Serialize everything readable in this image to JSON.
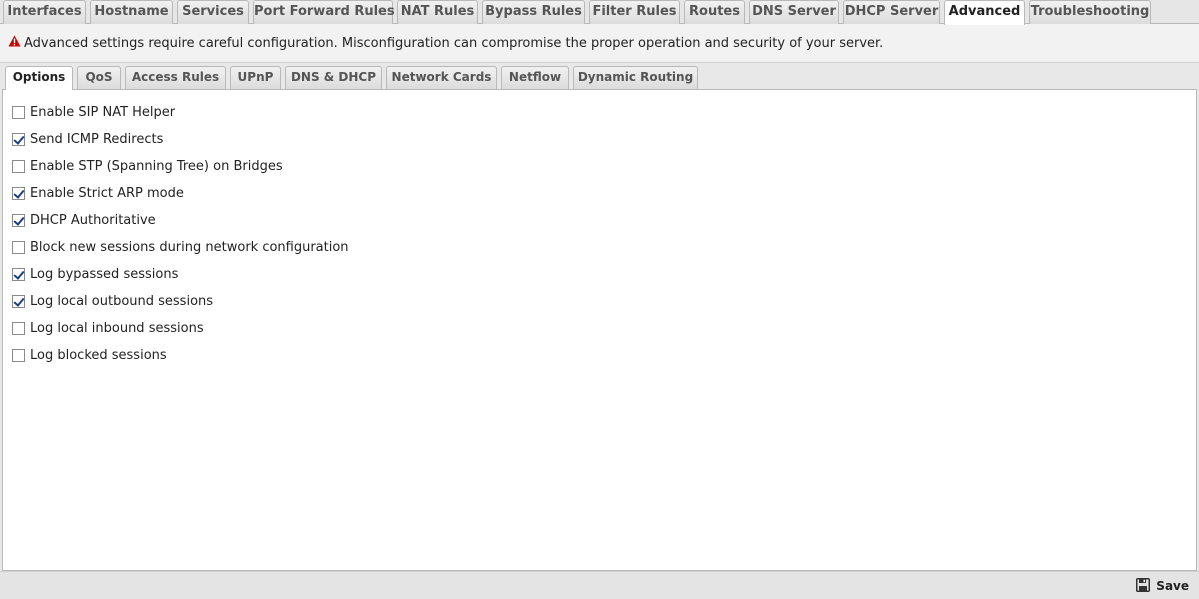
{
  "top_tabs": [
    {
      "label": "Interfaces",
      "active": false
    },
    {
      "label": "Hostname",
      "active": false
    },
    {
      "label": "Services",
      "active": false
    },
    {
      "label": "Port Forward Rules",
      "active": false
    },
    {
      "label": "NAT Rules",
      "active": false
    },
    {
      "label": "Bypass Rules",
      "active": false
    },
    {
      "label": "Filter Rules",
      "active": false
    },
    {
      "label": "Routes",
      "active": false
    },
    {
      "label": "DNS Server",
      "active": false
    },
    {
      "label": "DHCP Server",
      "active": false
    },
    {
      "label": "Advanced",
      "active": true
    },
    {
      "label": "Troubleshooting",
      "active": false
    }
  ],
  "warning": {
    "icon": "warning-icon",
    "text": "Advanced settings require careful configuration. Misconfiguration can compromise the proper operation and security of your server.",
    "icon_color": "#cc0000"
  },
  "sub_tabs": [
    {
      "label": "Options",
      "active": true
    },
    {
      "label": "QoS",
      "active": false
    },
    {
      "label": "Access Rules",
      "active": false
    },
    {
      "label": "UPnP",
      "active": false
    },
    {
      "label": "DNS & DHCP",
      "active": false
    },
    {
      "label": "Network Cards",
      "active": false
    },
    {
      "label": "Netflow",
      "active": false
    },
    {
      "label": "Dynamic Routing",
      "active": false
    }
  ],
  "options": [
    {
      "label": "Enable SIP NAT Helper",
      "checked": false
    },
    {
      "label": "Send ICMP Redirects",
      "checked": true
    },
    {
      "label": "Enable STP (Spanning Tree) on Bridges",
      "checked": false
    },
    {
      "label": "Enable Strict ARP mode",
      "checked": true
    },
    {
      "label": "DHCP Authoritative",
      "checked": true
    },
    {
      "label": "Block new sessions during network configuration",
      "checked": false
    },
    {
      "label": "Log bypassed sessions",
      "checked": true
    },
    {
      "label": "Log local outbound sessions",
      "checked": true
    },
    {
      "label": "Log local inbound sessions",
      "checked": false
    },
    {
      "label": "Log blocked sessions",
      "checked": false
    }
  ],
  "footer": {
    "save_label": "Save",
    "save_icon": "floppy-disk-icon"
  }
}
